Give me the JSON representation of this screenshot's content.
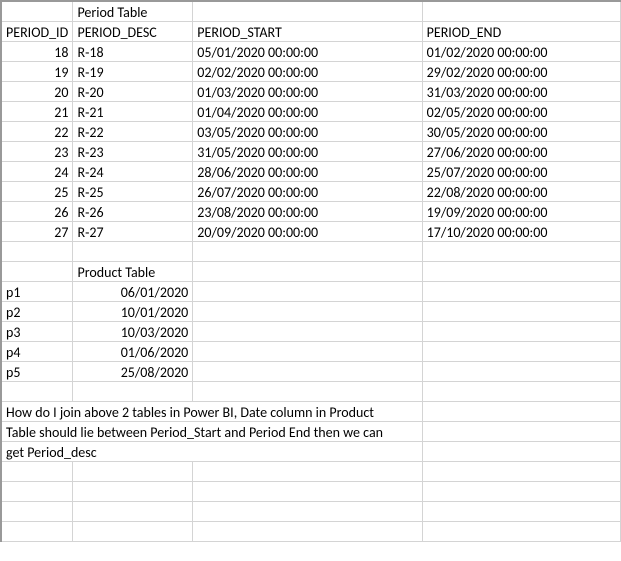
{
  "labels": {
    "period_table_title": "Period Table",
    "product_table_title": "Product Table"
  },
  "headers": {
    "period_id": "PERIOD_ID",
    "period_desc": "PERIOD_DESC",
    "period_start": "PERIOD_START",
    "period_end": "PERIOD_END"
  },
  "period_rows": [
    {
      "id": "18",
      "desc": "R-18",
      "start": "05/01/2020 00:00:00",
      "end": "01/02/2020 00:00:00"
    },
    {
      "id": "19",
      "desc": "R-19",
      "start": "02/02/2020 00:00:00",
      "end": "29/02/2020 00:00:00"
    },
    {
      "id": "20",
      "desc": "R-20",
      "start": "01/03/2020 00:00:00",
      "end": "31/03/2020 00:00:00"
    },
    {
      "id": "21",
      "desc": "R-21",
      "start": "01/04/2020 00:00:00",
      "end": "02/05/2020 00:00:00"
    },
    {
      "id": "22",
      "desc": "R-22",
      "start": "03/05/2020 00:00:00",
      "end": "30/05/2020 00:00:00"
    },
    {
      "id": "23",
      "desc": "R-23",
      "start": "31/05/2020 00:00:00",
      "end": "27/06/2020 00:00:00"
    },
    {
      "id": "24",
      "desc": "R-24",
      "start": "28/06/2020 00:00:00",
      "end": "25/07/2020 00:00:00"
    },
    {
      "id": "25",
      "desc": "R-25",
      "start": "26/07/2020 00:00:00",
      "end": "22/08/2020 00:00:00"
    },
    {
      "id": "26",
      "desc": "R-26",
      "start": "23/08/2020 00:00:00",
      "end": "19/09/2020 00:00:00"
    },
    {
      "id": "27",
      "desc": "R-27",
      "start": "20/09/2020 00:00:00",
      "end": "17/10/2020 00:00:00"
    }
  ],
  "product_rows": [
    {
      "name": "p1",
      "date": "06/01/2020"
    },
    {
      "name": "p2",
      "date": "10/01/2020"
    },
    {
      "name": "p3",
      "date": "10/03/2020"
    },
    {
      "name": "p4",
      "date": "01/06/2020"
    },
    {
      "name": "p5",
      "date": "25/08/2020"
    }
  ],
  "question": {
    "l1": "How do I join above 2 tables in Power BI, Date column in Product",
    "l2": "Table should lie between Period_Start and Period End then we can",
    "l3": "get Period_desc"
  }
}
